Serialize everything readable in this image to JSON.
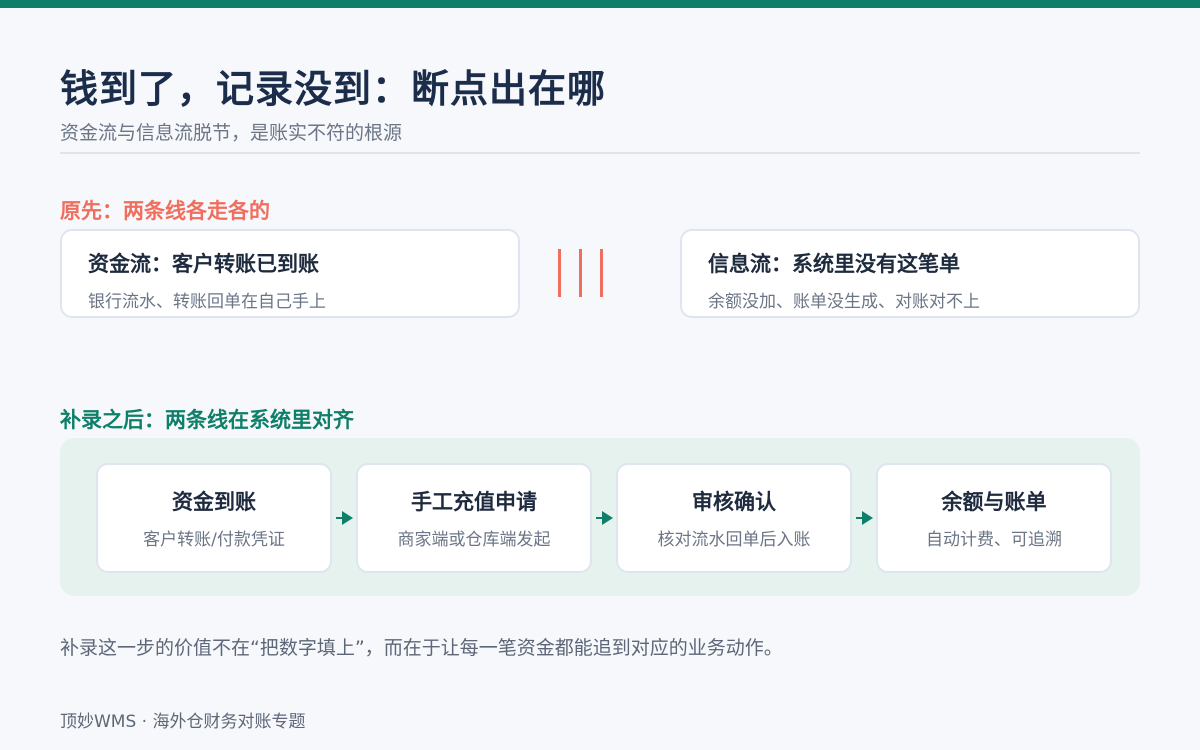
{
  "header": {
    "title": "钱到了，记录没到：断点出在哪",
    "subtitle": "资金流与信息流脱节，是账实不符的根源"
  },
  "before": {
    "heading": "原先：两条线各走各的",
    "money_flow": {
      "title": "资金流：客户转账已到账",
      "desc": "银行流水、转账回单在自己手上"
    },
    "info_flow": {
      "title": "信息流：系统里没有这笔单",
      "desc": "余额没加、账单没生成、对账对不上"
    }
  },
  "after": {
    "heading": "补录之后：两条线在系统里对齐",
    "steps": [
      {
        "title": "资金到账",
        "desc": "客户转账/付款凭证"
      },
      {
        "title": "手工充值申请",
        "desc": "商家端或仓库端发起"
      },
      {
        "title": "审核确认",
        "desc": "核对流水回单后入账"
      },
      {
        "title": "余额与账单",
        "desc": "自动计费、可追溯"
      }
    ]
  },
  "note": "补录这一步的价值不在“把数字填上”，而在于让每一笔资金都能追到对应的业务动作。",
  "footer": "顶妙WMS · 海外仓财务对账专题",
  "colors": {
    "brand": "#0f7f6a",
    "alert": "#ef6e5e",
    "title": "#1b2d4a",
    "panel": "#e6f2ee"
  }
}
